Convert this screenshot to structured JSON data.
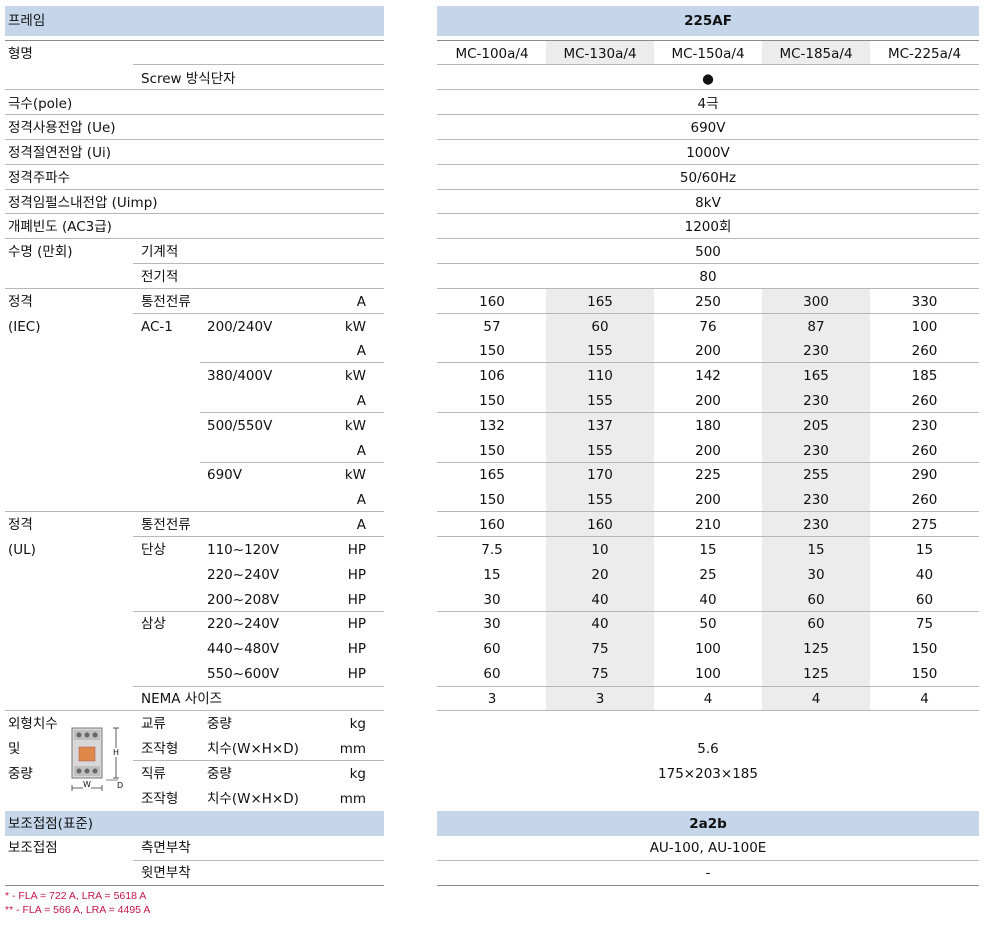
{
  "left": {
    "frame_label": "프레임",
    "model_label": "형명",
    "screw_label": "Screw 방식단자",
    "poles_label": "극수(pole)",
    "ue_label": "정격사용전압 (Ue)",
    "ui_label": "정격절연전압 (Ui)",
    "freq_label": "정격주파수",
    "uimp_label": "정격임펄스내전압 (Uimp)",
    "ops_label": "개폐빈도 (AC3급)",
    "life_label": "수명 (만회)",
    "life_mech": "기계적",
    "life_elec": "전기적",
    "iec_l1": "정격",
    "iec_l2": "(IEC)",
    "ith_label": "통전전류",
    "ac1_label": "AC-1",
    "v1": "200/240V",
    "v2": "380/400V",
    "v3": "500/550V",
    "v4": "690V",
    "unit_a": "A",
    "unit_kw": "kW",
    "unit_hp": "HP",
    "ul_l1": "정격",
    "ul_l2": "(UL)",
    "single_phase": "단상",
    "three_phase": "삼상",
    "uv1": "110~120V",
    "uv2": "220~240V",
    "uv3": "200~208V",
    "uv4": "220~240V",
    "uv5": "440~480V",
    "uv6": "550~600V",
    "nema_label": "NEMA 사이즈",
    "dim_l1": "외형치수",
    "dim_l2": "및",
    "dim_l3": "중량",
    "ac_label": "교류",
    "dc_label": "직류",
    "op_label": "조작형",
    "weight_label": "중량",
    "size_label": "치수(W×H×D)",
    "unit_kg": "kg",
    "unit_mm": "mm",
    "aux_std_label": "보조접점(표준)",
    "aux_label": "보조접점",
    "side_mount": "측면부착",
    "rear_mount": "윗면부착",
    "dim_w": "W",
    "dim_h": "H",
    "dim_d": "D"
  },
  "right": {
    "frame": "225AF",
    "models": [
      "MC-100a/4",
      "MC-130a/4",
      "MC-150a/4",
      "MC-185a/4",
      "MC-225a/4"
    ],
    "screw": "●",
    "poles": "4극",
    "ue": "690V",
    "ui": "1000V",
    "freq": "50/60Hz",
    "uimp": "8kV",
    "ops": "1200회",
    "life_mech": "500",
    "life_elec": "80",
    "iec_rows": [
      [
        "160",
        "165",
        "250",
        "300",
        "330"
      ],
      [
        "57",
        "60",
        "76",
        "87",
        "100"
      ],
      [
        "150",
        "155",
        "200",
        "230",
        "260"
      ],
      [
        "106",
        "110",
        "142",
        "165",
        "185"
      ],
      [
        "150",
        "155",
        "200",
        "230",
        "260"
      ],
      [
        "132",
        "137",
        "180",
        "205",
        "230"
      ],
      [
        "150",
        "155",
        "200",
        "230",
        "260"
      ],
      [
        "165",
        "170",
        "225",
        "255",
        "290"
      ],
      [
        "150",
        "155",
        "200",
        "230",
        "260"
      ]
    ],
    "ul_rows": [
      [
        "160",
        "160",
        "210",
        "230",
        "275"
      ],
      [
        "7.5",
        "10",
        "15",
        "15",
        "15"
      ],
      [
        "15",
        "20",
        "25",
        "30",
        "40"
      ],
      [
        "30",
        "40",
        "40",
        "60",
        "60"
      ],
      [
        "30",
        "40",
        "50",
        "60",
        "75"
      ],
      [
        "60",
        "75",
        "100",
        "125",
        "150"
      ],
      [
        "60",
        "75",
        "100",
        "125",
        "150"
      ],
      [
        "3",
        "3",
        "4",
        "4",
        "4"
      ]
    ],
    "weight": "5.6",
    "dims": "175×203×185",
    "aux_std": "2a2b",
    "aux_side": "AU-100, AU-100E",
    "aux_rear": "-"
  },
  "footnotes": {
    "f1": "* - FLA = 722 A, LRA = 5618 A",
    "f2": "** - FLA = 566 A, LRA = 4495 A"
  },
  "colors": {
    "header_band": "#c5d6ea",
    "shade": "#ececec",
    "footnote": "#c0144b"
  }
}
